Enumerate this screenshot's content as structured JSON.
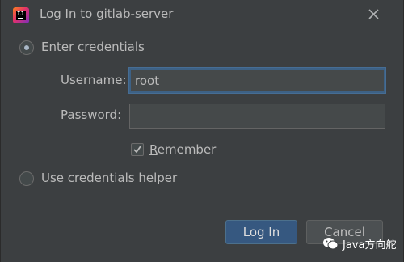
{
  "window": {
    "title": "Log In to gitlab-server",
    "app_icon_letters": "IJ"
  },
  "auth_options": {
    "enter_credentials": {
      "label": "Enter credentials",
      "selected": true
    },
    "credentials_helper": {
      "label": "Use credentials helper",
      "selected": false
    }
  },
  "form": {
    "username": {
      "label": "Username:",
      "value": "root"
    },
    "password": {
      "label": "Password:",
      "value": ""
    },
    "remember": {
      "label_mnemonic": "R",
      "label_rest": "emember",
      "checked": true
    }
  },
  "buttons": {
    "login": "Log In",
    "cancel": "Cancel"
  },
  "watermark": {
    "text": "Java方向舵"
  },
  "colors": {
    "background": "#3c3f41",
    "primary_button": "#365880",
    "focus_border": "#3d6185"
  }
}
